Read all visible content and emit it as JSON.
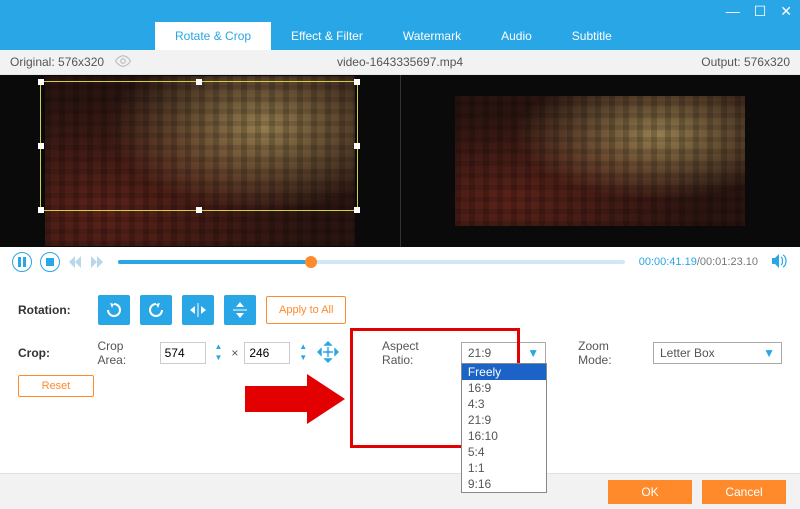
{
  "window": {
    "filename": "video-1643335697.mp4"
  },
  "tabs": {
    "rotate": "Rotate & Crop",
    "effect": "Effect & Filter",
    "watermark": "Watermark",
    "audio": "Audio",
    "subtitle": "Subtitle"
  },
  "info": {
    "original_label": "Original:",
    "original_dim": "576x320",
    "output_label": "Output:",
    "output_dim": "576x320"
  },
  "playback": {
    "current": "00:00:41.19",
    "total": "/00:01:23.10"
  },
  "rotation": {
    "label": "Rotation:",
    "apply_all": "Apply to All"
  },
  "crop": {
    "label": "Crop:",
    "area_label": "Crop Area:",
    "width": "574",
    "sep": "×",
    "height": "246",
    "aspect_label": "Aspect Ratio:",
    "aspect_value": "21:9",
    "zoom_label": "Zoom Mode:",
    "zoom_value": "Letter Box",
    "reset": "Reset",
    "options": [
      "Freely",
      "16:9",
      "4:3",
      "21:9",
      "16:10",
      "5:4",
      "1:1",
      "9:16"
    ]
  },
  "footer": {
    "ok": "OK",
    "cancel": "Cancel"
  }
}
